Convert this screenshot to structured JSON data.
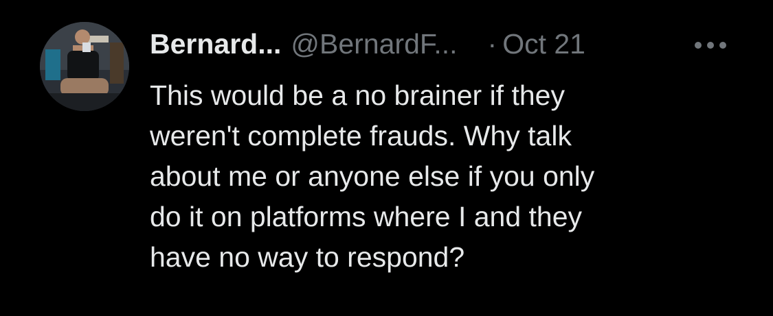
{
  "tweet": {
    "author": {
      "display_name": "Bernard...",
      "handle": "@BernardF...",
      "avatar_icon": "user-photo-avatar"
    },
    "separator": "·",
    "date": "Oct 21",
    "more_icon": "more-horizontal-icon",
    "text_lines": [
      "This would be a no brainer if they",
      "weren't complete frauds. Why talk",
      "about me or anyone else if you only",
      "do it on platforms where I and they",
      "have no way to respond?"
    ]
  },
  "colors": {
    "background": "#000000",
    "primary_text": "#e7e9ea",
    "secondary_text": "#71767b"
  }
}
